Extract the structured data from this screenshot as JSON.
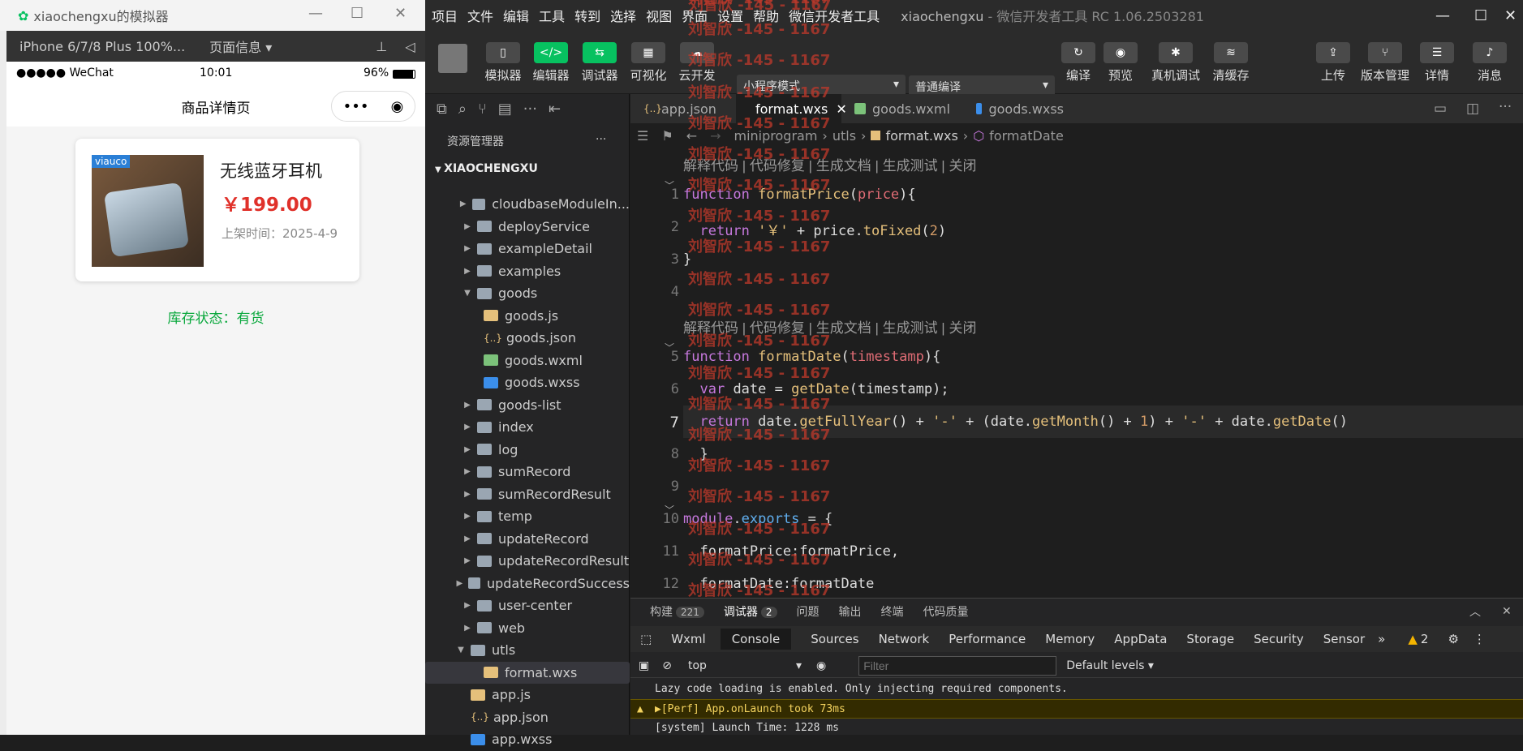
{
  "simulator": {
    "title": "xiaochengxu的模拟器",
    "device": "iPhone 6/7/8 Plus 100%...",
    "page_info": "页面信息 ▾",
    "status_left": "●●●●● WeChat",
    "time": "10:01",
    "battery": "96%",
    "nav_title": "商品详情页",
    "capsule_more": "•••",
    "capsule_close": "◉",
    "product": {
      "brand": "viauco",
      "name": "无线蓝牙耳机",
      "price": "￥199.00",
      "date": "上架时间：2025-4-9"
    },
    "stock": "库存状态：有货"
  },
  "menu": [
    "项目",
    "文件",
    "编辑",
    "工具",
    "转到",
    "选择",
    "视图",
    "界面",
    "设置",
    "帮助",
    "微信开发者工具"
  ],
  "app_title": "xiaochengxu",
  "app_sub": " - 微信开发者工具 RC 1.06.2503281",
  "toolbar": {
    "simulator": "模拟器",
    "editor": "编辑器",
    "debugger": "调试器",
    "visual": "可视化",
    "cloud": "云开发",
    "mode": "小程序模式",
    "compile_mode": "普通编译",
    "compile": "编译",
    "preview": "预览",
    "real_debug": "真机调试",
    "clear_cache": "清缓存",
    "upload": "上传",
    "version": "版本管理",
    "details": "详情",
    "messages": "消息"
  },
  "explorer": {
    "header": "资源管理器",
    "more": "···",
    "project": "XIAOCHENGXU",
    "items": [
      {
        "label": "cloudbaseModuleIn...",
        "arrow": "▶"
      },
      {
        "label": "deployService",
        "arrow": "▶"
      },
      {
        "label": "exampleDetail",
        "arrow": "▶"
      },
      {
        "label": "examples",
        "arrow": "▶"
      },
      {
        "label": "goods",
        "arrow": "▼"
      },
      {
        "label": "goods.js",
        "arrow": ""
      },
      {
        "label": "goods.json",
        "arrow": ""
      },
      {
        "label": "goods.wxml",
        "arrow": ""
      },
      {
        "label": "goods.wxss",
        "arrow": ""
      },
      {
        "label": "goods-list",
        "arrow": "▶"
      },
      {
        "label": "index",
        "arrow": "▶"
      },
      {
        "label": "log",
        "arrow": "▶"
      },
      {
        "label": "sumRecord",
        "arrow": "▶"
      },
      {
        "label": "sumRecordResult",
        "arrow": "▶"
      },
      {
        "label": "temp",
        "arrow": "▶"
      },
      {
        "label": "updateRecord",
        "arrow": "▶"
      },
      {
        "label": "updateRecordResult",
        "arrow": "▶"
      },
      {
        "label": "updateRecordSuccess",
        "arrow": "▶"
      },
      {
        "label": "user-center",
        "arrow": "▶"
      },
      {
        "label": "web",
        "arrow": "▶"
      },
      {
        "label": "utls",
        "arrow": "▼"
      },
      {
        "label": "format.wxs",
        "arrow": ""
      },
      {
        "label": "app.js",
        "arrow": ""
      },
      {
        "label": "app.json",
        "arrow": ""
      },
      {
        "label": "app.wxss",
        "arrow": ""
      }
    ]
  },
  "tabs": [
    {
      "label": "app.json"
    },
    {
      "label": "format.wxs",
      "close": "✕"
    },
    {
      "label": "goods.wxml"
    },
    {
      "label": "goods.wxss"
    }
  ],
  "breadcrumb": {
    "root": "miniprogram",
    "folder": "utls",
    "file": "format.wxs",
    "symbol": "formatDate"
  },
  "codelens": "解释代码 | 代码修复 | 生成文档 | 生成测试 | 关闭",
  "line_numbers": [
    "1",
    "2",
    "3",
    "4",
    "5",
    "6",
    "7",
    "8",
    "9",
    "10",
    "11",
    "12"
  ],
  "watermark": "刘智欣 -145 - 1167",
  "panel": {
    "build": "构建",
    "build_count": "221",
    "debugger": "调试器",
    "debugger_count": "2",
    "issues": "问题",
    "output": "输出",
    "terminal": "终端",
    "quality": "代码质量"
  },
  "devtools": {
    "tabs": [
      "Wxml",
      "Console",
      "Sources",
      "Network",
      "Performance",
      "Memory",
      "AppData",
      "Storage",
      "Security",
      "Sensor"
    ],
    "warn_count": "2",
    "context": "top",
    "filter_placeholder": "Filter",
    "levels": "Default levels ▾",
    "lines": [
      "Lazy code loading is enabled. Only injecting required components.",
      "▶[Perf] App.onLaunch took 73ms",
      "[system] Launch Time: 1228 ms"
    ]
  }
}
